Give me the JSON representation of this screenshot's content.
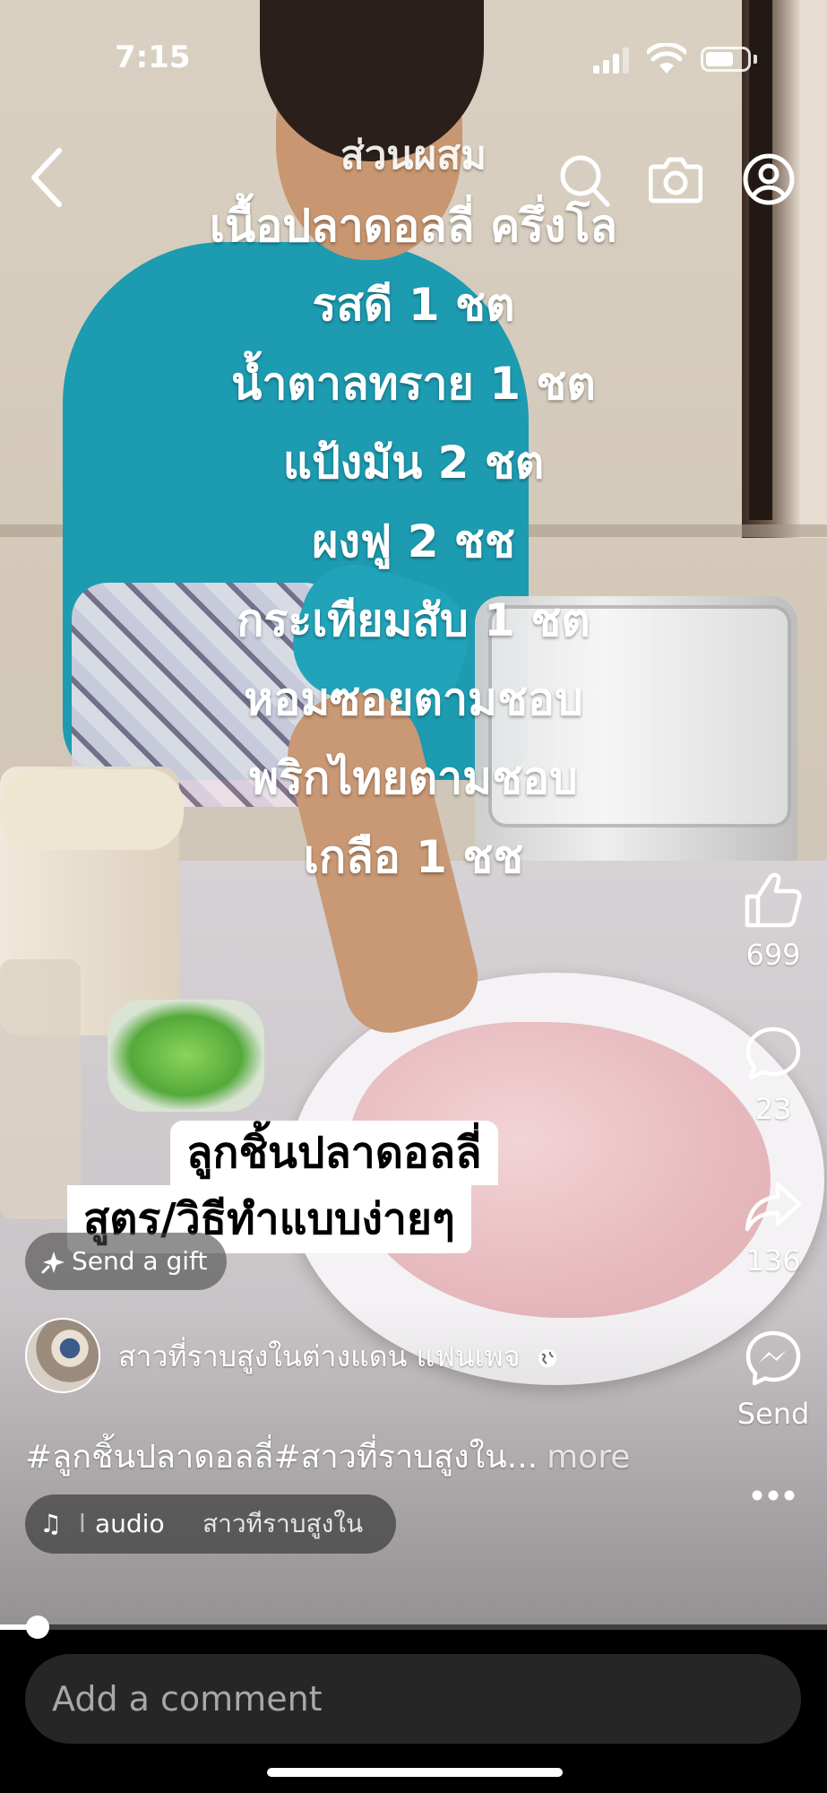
{
  "status_bar": {
    "time": "7:15"
  },
  "nav": {
    "back_icon": "chevron-left-icon",
    "search_icon": "search-icon",
    "camera_icon": "camera-icon",
    "profile_icon": "user-circle-icon"
  },
  "recipe": {
    "lines": [
      "ส่วนผสม",
      "เนื้อปลาดอลลี่ ครึ่งโล",
      "รสดี 1 ชต",
      "น้ำตาลทราย 1 ชต",
      "แป้งมัน 2 ชต",
      "ผงฟู 2 ชช",
      "กระเทียมสับ 1 ชต",
      "หอมซอยตามชอบ",
      "พริกไทยตามชอบ",
      "เกลือ 1 ชช"
    ]
  },
  "caption": {
    "line1": "ลูกชิ้นปลาดอลลี่",
    "line2": "สูตร/วิธีทำแบบง่ายๆ"
  },
  "actions": {
    "like_count": "699",
    "comment_count": "23",
    "share_count": "136",
    "send_label": "Send",
    "more_icon": "more-horizontal-icon"
  },
  "gift": {
    "label": "Send a gift"
  },
  "author": {
    "name": "สาวที่ราบสูงในต่างแดน แฟนเพจ",
    "privacy_icon": "globe-icon"
  },
  "description": {
    "hashtags": "#ลูกชิ้นปลาดอลลี่#สาวที่ราบสูงใน...",
    "more_label": "more"
  },
  "audio": {
    "separator": "l",
    "label": "audio",
    "artist": "สาวทีราบสูงใน"
  },
  "playback": {
    "progress": 0.045
  },
  "comment": {
    "placeholder": "Add a comment"
  },
  "colors": {
    "overlay_text": "#ffffff",
    "comment_bar": "#262626",
    "background": "#000000"
  }
}
